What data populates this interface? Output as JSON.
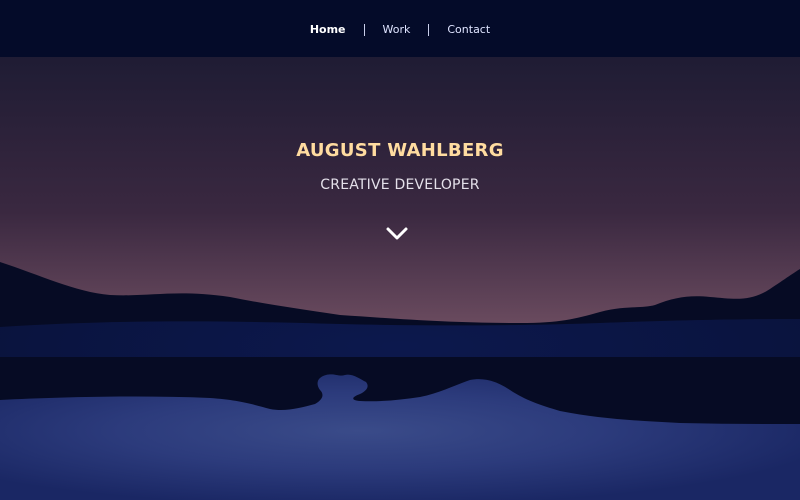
{
  "nav": {
    "items": [
      {
        "label": "Home",
        "active": true
      },
      {
        "label": "Work",
        "active": false
      },
      {
        "label": "Contact",
        "active": false
      }
    ],
    "separator": "|"
  },
  "hero": {
    "title": "AUGUST WAHLBERG",
    "subtitle": "CREATIVE DEVELOPER",
    "scroll_icon": "chevron-down-icon"
  },
  "colors": {
    "nav_bg": "#040b29",
    "title": "#ffdca0",
    "subtitle": "#e4e0ea",
    "sky_top": "#1f1c34",
    "sky_bottom": "#b08e9d",
    "mountains": "#060b24",
    "water": "#2c3b7c"
  }
}
